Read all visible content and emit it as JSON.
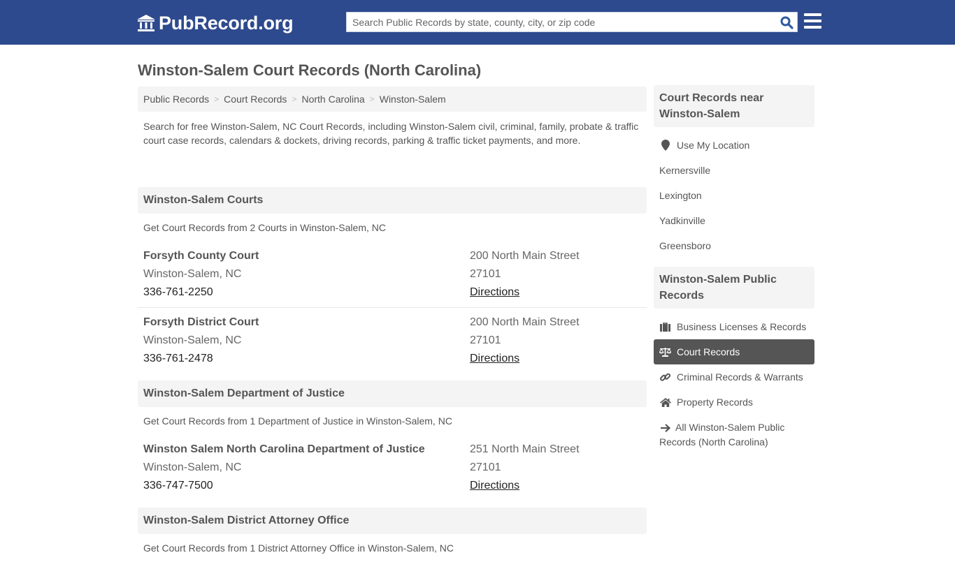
{
  "header": {
    "brand": "PubRecord.org",
    "search_placeholder": "Search Public Records by state, county, city, or zip code",
    "search_value": "",
    "colors": {
      "topbar": "#2e4a8e",
      "search_icon": "#2e4a8e"
    }
  },
  "page": {
    "title": "Winston-Salem Court Records (North Carolina)",
    "breadcrumb": [
      {
        "label": "Public Records"
      },
      {
        "label": "Court Records"
      },
      {
        "label": "North Carolina"
      },
      {
        "label": "Winston-Salem"
      }
    ],
    "intro": "Search for free Winston-Salem, NC Court Records, including Winston-Salem civil, criminal, family, probate & traffic court case records, calendars & dockets, driving records, parking & traffic ticket payments, and more."
  },
  "sections": [
    {
      "heading": "Winston-Salem Courts",
      "subtitle": "Get Court Records from 2 Courts in Winston-Salem, NC",
      "entries": [
        {
          "name": "Forsyth County Court",
          "city": "Winston-Salem, NC",
          "phone": "336-761-2250",
          "address": "200 North Main Street",
          "zip": "27101",
          "directions": "Directions"
        },
        {
          "name": "Forsyth District Court",
          "city": "Winston-Salem, NC",
          "phone": "336-761-2478",
          "address": "200 North Main Street",
          "zip": "27101",
          "directions": "Directions"
        }
      ]
    },
    {
      "heading": "Winston-Salem Department of Justice",
      "subtitle": "Get Court Records from 1 Department of Justice in Winston-Salem, NC",
      "entries": [
        {
          "name": "Winston Salem North Carolina Department of Justice",
          "city": "Winston-Salem, NC",
          "phone": "336-747-7500",
          "address": "251 North Main Street",
          "zip": "27101",
          "directions": "Directions"
        }
      ]
    },
    {
      "heading": "Winston-Salem District Attorney Office",
      "subtitle": "Get Court Records from 1 District Attorney Office in Winston-Salem, NC",
      "entries": []
    }
  ],
  "sidebar": {
    "nearby": {
      "heading": "Court Records near Winston-Salem",
      "use_location": {
        "label": "Use My Location",
        "icon": "map-marker-icon"
      },
      "cities": [
        "Kernersville",
        "Lexington",
        "Yadkinville",
        "Greensboro"
      ]
    },
    "public_records": {
      "heading": "Winston-Salem Public Records",
      "items": [
        {
          "label": "Business Licenses & Records",
          "icon": "briefcase-icon",
          "active": false
        },
        {
          "label": "Court Records",
          "icon": "balance-scale-icon",
          "active": true
        },
        {
          "label": "Criminal Records & Warrants",
          "icon": "link-icon",
          "active": false
        },
        {
          "label": "Property Records",
          "icon": "home-icon",
          "active": false
        },
        {
          "label": "All Winston-Salem Public Records (North Carolina)",
          "icon": "arrow-right-icon",
          "active": false
        }
      ]
    }
  }
}
